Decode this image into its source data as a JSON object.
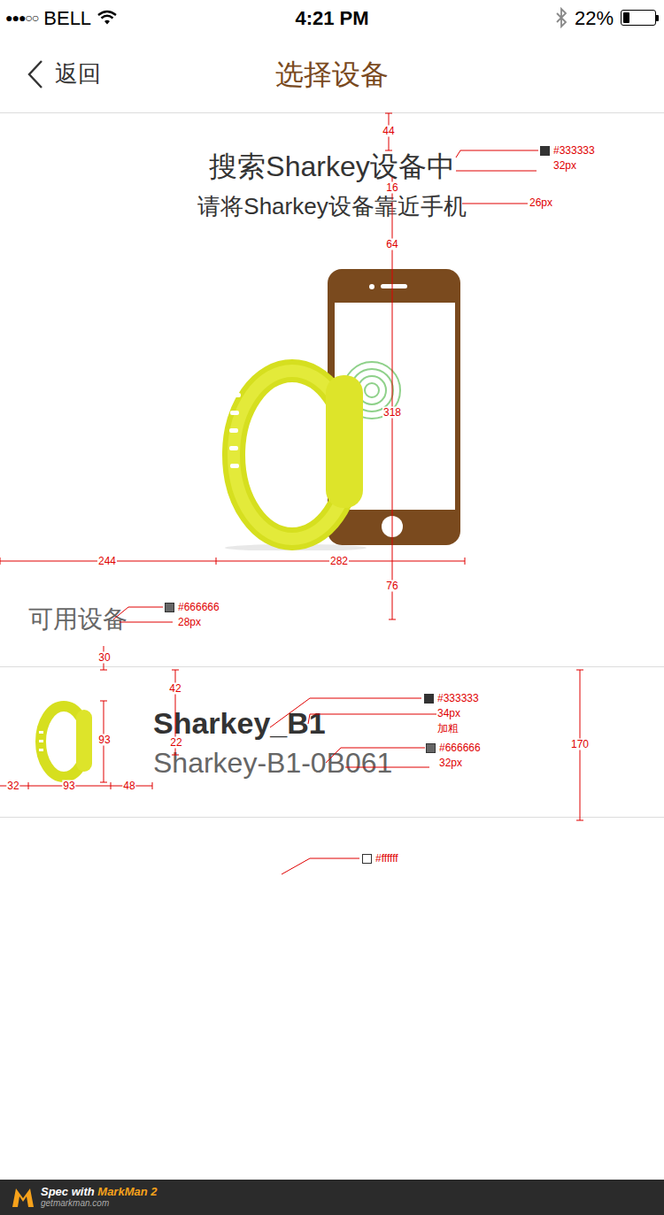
{
  "status_bar": {
    "signal": "●●●○○",
    "carrier": "BELL",
    "time": "4:21 PM",
    "battery": "22%",
    "battery_level": 0.22
  },
  "nav": {
    "back": "返回",
    "title": "选择设备"
  },
  "search": {
    "title": "搜索Sharkey设备中",
    "hint": "请将Sharkey设备靠近手机"
  },
  "section": {
    "title": "可用设备"
  },
  "devices": [
    {
      "name": "Sharkey_B1",
      "id": "Sharkey-B1-0B061"
    }
  ],
  "spec": {
    "marks": [
      "44",
      "16",
      "64",
      "318",
      "244",
      "282",
      "76",
      "30",
      "42",
      "22",
      "93",
      "93",
      "32",
      "48",
      "170"
    ],
    "notes": [
      {
        "color": "#333333",
        "lines": [
          "#333333",
          "32px"
        ]
      },
      {
        "color": null,
        "lines": [
          "26px"
        ]
      },
      {
        "color": "#666666",
        "lines": [
          "#666666",
          "28px"
        ]
      },
      {
        "color": "#333333",
        "lines": [
          "#333333",
          "34px",
          "加粗"
        ]
      },
      {
        "color": "#666666",
        "lines": [
          "#666666",
          "32px"
        ]
      },
      {
        "color": "#ffffff",
        "lines": [
          "#ffffff"
        ]
      }
    ]
  },
  "footer": {
    "prefix": "Spec with",
    "brand": "MarkMan 2",
    "url": "getmarkman.com"
  }
}
